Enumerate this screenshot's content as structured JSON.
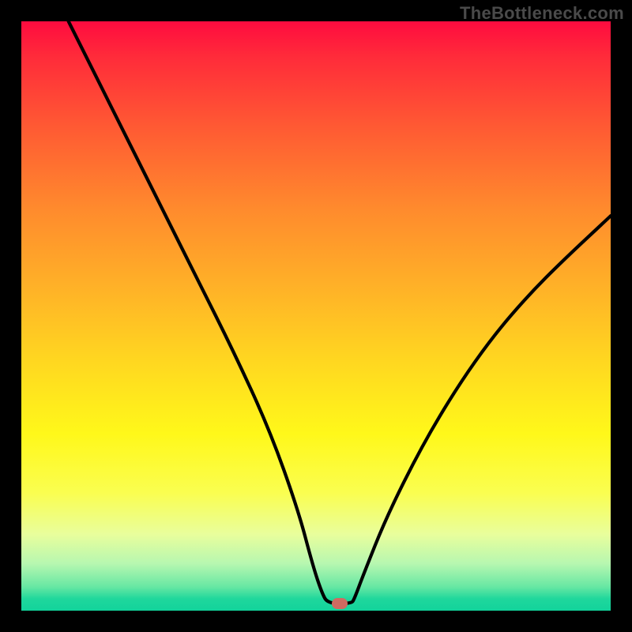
{
  "watermark": "TheBottleneck.com",
  "chart_data": {
    "type": "line",
    "title": "",
    "xlabel": "",
    "ylabel": "",
    "xlim": [
      0,
      100
    ],
    "ylim": [
      0,
      100
    ],
    "series": [
      {
        "name": "curve",
        "x": [
          8,
          12,
          18,
          24,
          30,
          36,
          42,
          47,
          49.5,
          51,
          52,
          56,
          56.5,
          58,
          62,
          68,
          74,
          80,
          86,
          92,
          100
        ],
        "y": [
          100,
          92,
          80,
          68,
          56,
          44,
          31,
          17,
          7.5,
          3,
          1.2,
          1.2,
          2,
          6,
          16,
          28,
          38,
          46.5,
          53.5,
          59.5,
          67
        ]
      }
    ],
    "marker": {
      "x": 54,
      "y": 1.2
    }
  },
  "colors": {
    "curve": "#000000",
    "marker": "#d06a61",
    "frame": "#000000"
  }
}
